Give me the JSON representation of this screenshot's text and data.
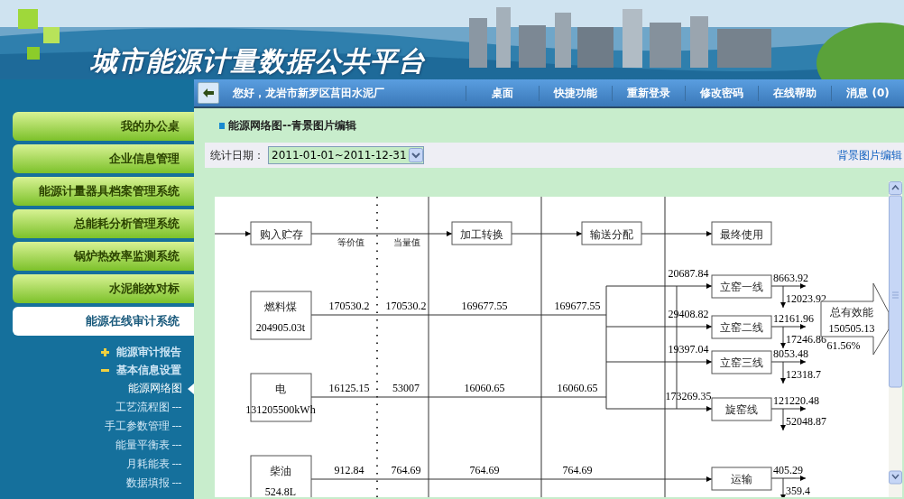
{
  "header": {
    "title": "城市能源计量数据公共平台"
  },
  "navbar": {
    "greeting": "您好，龙岩市新罗区莒田水泥厂",
    "items": [
      "桌面",
      "快捷功能",
      "重新登录",
      "修改密码",
      "在线帮助",
      "消息 (0)"
    ]
  },
  "sidebar": {
    "items": [
      {
        "label": "我的办公桌",
        "selected": false
      },
      {
        "label": "企业信息管理",
        "selected": false
      },
      {
        "label": "能源计量器具档案管理系统",
        "selected": false
      },
      {
        "label": "总能耗分析管理系统",
        "selected": false
      },
      {
        "label": "锅炉热效率监测系统",
        "selected": false
      },
      {
        "label": "水泥能效对标",
        "selected": false
      },
      {
        "label": "能源在线审计系统",
        "selected": true
      }
    ],
    "tree": [
      {
        "label": "能源审计报告",
        "expanded": false
      },
      {
        "label": "基本信息设置",
        "expanded": true,
        "children": [
          {
            "label": "能源网络图",
            "selected": true
          },
          {
            "label": "工艺流程图",
            "selected": false
          },
          {
            "label": "手工参数管理",
            "selected": false
          },
          {
            "label": "能量平衡表",
            "selected": false
          },
          {
            "label": "月耗能表",
            "selected": false
          },
          {
            "label": "数据填报",
            "selected": false
          }
        ]
      }
    ]
  },
  "page": {
    "title": "能源网络图--青景图片编辑",
    "filter_label": "统计日期：",
    "date_range": "2011-01-01~2011-12-31",
    "link": "背景图片编辑"
  },
  "diagram": {
    "stages": [
      "购入贮存",
      "加工转换",
      "输送分配",
      "最终使用"
    ],
    "columns": [
      "等价值",
      "当量值"
    ],
    "sources": [
      {
        "name": "燃料煤",
        "amount": "204905.03t",
        "values": [
          "170530.2",
          "170530.2",
          "169677.55",
          "169677.55"
        ]
      },
      {
        "name": "电",
        "amount": "131205500kWh",
        "values": [
          "16125.15",
          "53007",
          "16060.65",
          "16060.65"
        ]
      },
      {
        "name": "柴油",
        "amount": "524.8L",
        "values": [
          "912.84",
          "764.69",
          "764.69",
          "764.69"
        ]
      }
    ],
    "consumers": [
      {
        "name": "立窑一线",
        "input": "20687.84",
        "outputs": [
          "8663.92",
          "12023.92"
        ]
      },
      {
        "name": "立窑二线",
        "input": "29408.82",
        "outputs": [
          "12161.96",
          "17246.86"
        ]
      },
      {
        "name": "立窑三线",
        "input": "19397.04",
        "outputs": [
          "8053.48",
          "12318.7"
        ]
      },
      {
        "name": "旋窑线",
        "input": "173269.35",
        "outputs": [
          "121220.48",
          "52048.87"
        ]
      },
      {
        "name": "运输",
        "outputs": [
          "405.29",
          "359.4"
        ]
      }
    ],
    "total": {
      "label": "总有效能",
      "value": "150505.13",
      "percent": "61.56%"
    }
  }
}
